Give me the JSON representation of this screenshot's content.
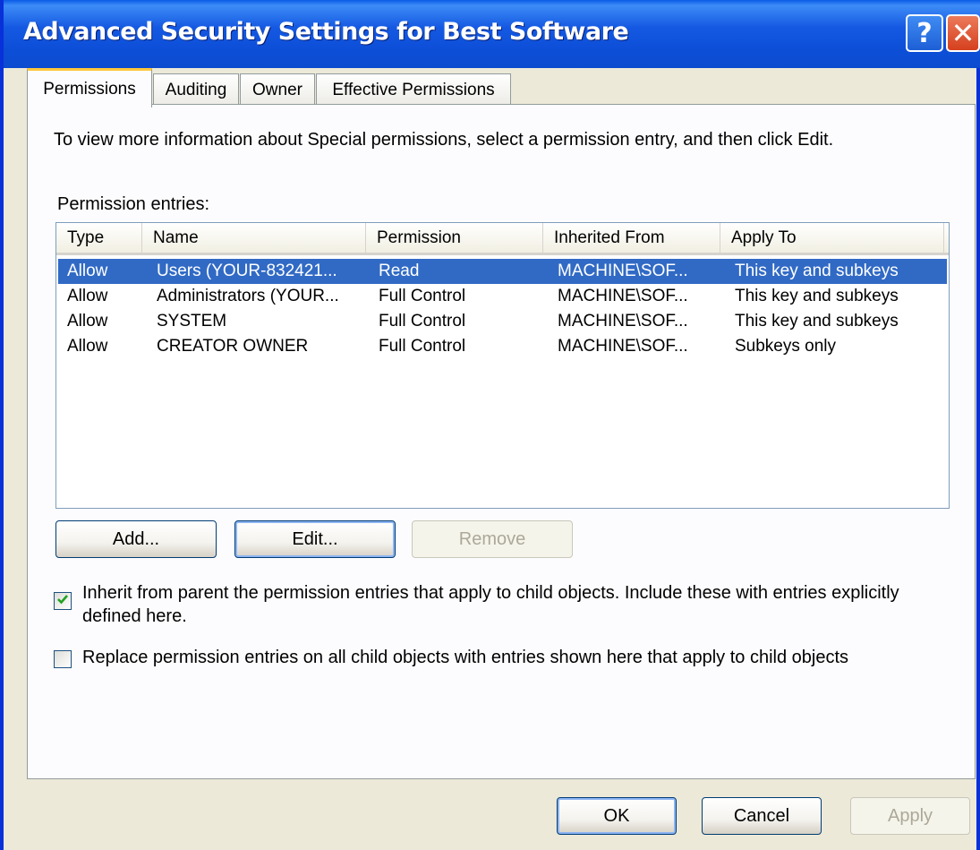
{
  "window": {
    "title": "Advanced Security Settings for Best Software",
    "help_glyph": "?",
    "close_glyph": "✕"
  },
  "tabs": [
    {
      "label": "Permissions",
      "active": true
    },
    {
      "label": "Auditing",
      "active": false
    },
    {
      "label": "Owner",
      "active": false
    },
    {
      "label": "Effective Permissions",
      "active": false
    }
  ],
  "permissions": {
    "info_text": "To view more information about Special permissions, select a permission entry, and then click Edit.",
    "entries_label": "Permission entries:",
    "columns": [
      "Type",
      "Name",
      "Permission",
      "Inherited From",
      "Apply To"
    ],
    "rows": [
      [
        "Allow",
        "Users (YOUR-832421...",
        "Read",
        "MACHINE\\SOF...",
        "This key and subkeys"
      ],
      [
        "Allow",
        "Administrators (YOUR...",
        "Full Control",
        "MACHINE\\SOF...",
        "This key and subkeys"
      ],
      [
        "Allow",
        "SYSTEM",
        "Full Control",
        "MACHINE\\SOF...",
        "This key and subkeys"
      ],
      [
        "Allow",
        "CREATOR OWNER",
        "Full Control",
        "MACHINE\\SOF...",
        "Subkeys only"
      ]
    ],
    "selected_row": 0,
    "add_label": "Add...",
    "edit_label": "Edit...",
    "remove_label": "Remove",
    "inherit_checkbox": {
      "checked": true,
      "line1": "Inherit from parent the permission entries that apply to child objects. Include these with entries explicitly",
      "line2": "defined here."
    },
    "replace_checkbox": {
      "checked": false,
      "label": "Replace permission entries on all child objects with entries shown here that apply to child objects"
    }
  },
  "footer": {
    "ok_label": "OK",
    "cancel_label": "Cancel",
    "apply_label": "Apply"
  },
  "colors": {
    "titlebar": "#0b4bd0",
    "selection": "#316ac5",
    "dialog_bg": "#ece9d8",
    "check": "#21a121"
  }
}
